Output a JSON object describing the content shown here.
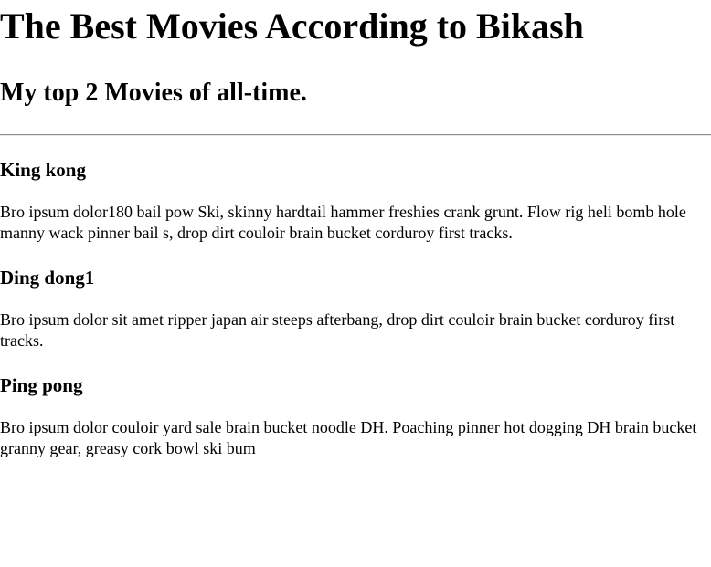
{
  "page": {
    "title": "The Best Movies According to Bikash",
    "subtitle": "My top 2 Movies of all-time."
  },
  "movies": [
    {
      "title": "King kong",
      "description": "Bro ipsum dolor180 bail pow Ski, skinny hardtail hammer freshies crank grunt. Flow rig heli bomb hole manny wack pinner bail s, drop dirt couloir brain bucket corduroy first tracks."
    },
    {
      "title": "Ding dong1",
      "description": "Bro ipsum dolor sit amet ripper japan air steeps afterbang, drop dirt couloir brain bucket corduroy first tracks."
    },
    {
      "title": "Ping pong",
      "description": "Bro ipsum dolor couloir yard sale brain bucket noodle DH. Poaching pinner hot dogging DH brain bucket granny gear, greasy cork bowl ski bum"
    }
  ]
}
